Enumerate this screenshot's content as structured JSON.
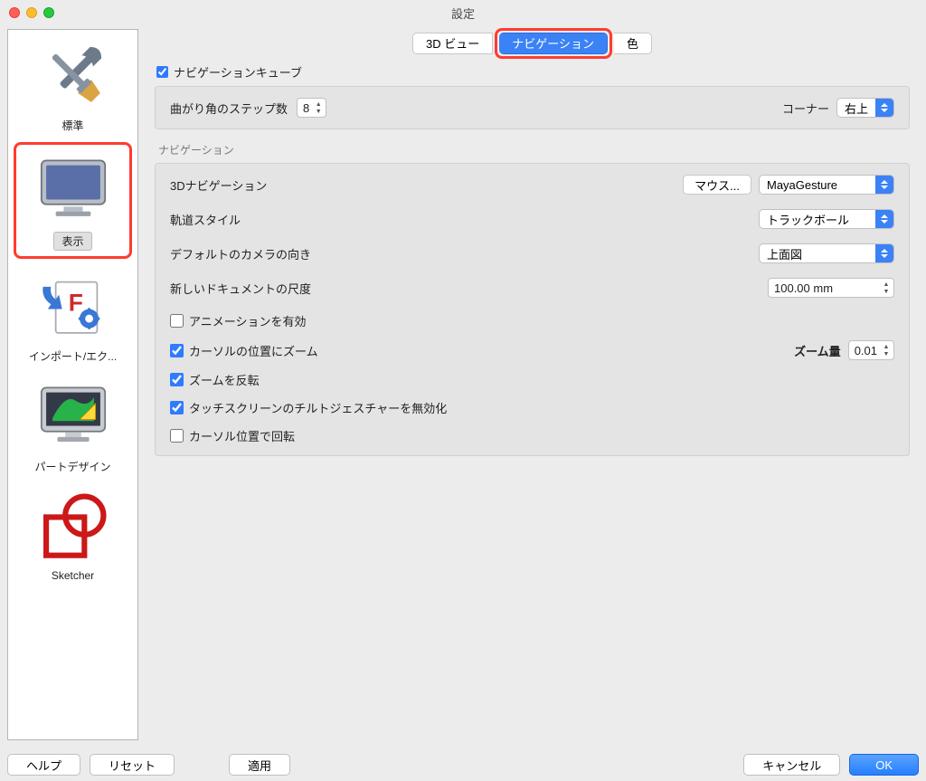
{
  "window": {
    "title": "設定"
  },
  "sidebar": {
    "items": [
      {
        "label": "標準"
      },
      {
        "label": "表示"
      },
      {
        "label": "インポート/エク..."
      },
      {
        "label": "パートデザイン"
      },
      {
        "label": "Sketcher"
      }
    ]
  },
  "tabs": {
    "view3d": "3D ビュー",
    "navigation": "ナビゲーション",
    "color": "色"
  },
  "navcube": {
    "checkbox": "ナビゲーションキューブ",
    "steps_label": "曲がり角のステップ数",
    "steps_value": "8",
    "corner_label": "コーナー",
    "corner_value": "右上"
  },
  "navigation_section": {
    "title": "ナビゲーション",
    "nav3d_label": "3Dナビゲーション",
    "mouse_btn": "マウス...",
    "nav3d_value": "MayaGesture",
    "orbit_label": "軌道スタイル",
    "orbit_value": "トラックボール",
    "camera_label": "デフォルトのカメラの向き",
    "camera_value": "上面図",
    "newdoc_label": "新しいドキュメントの尺度",
    "newdoc_value": "100.00 mm",
    "anim_label": "アニメーションを有効",
    "zoomcursor_label": "カーソルの位置にズーム",
    "zoomstep_label": "ズーム量",
    "zoomstep_value": "0.01",
    "invertzoom_label": "ズームを反転",
    "disable_tilt_label": "タッチスクリーンのチルトジェスチャーを無効化",
    "rotate_cursor_label": "カーソル位置で回転"
  },
  "buttons": {
    "help": "ヘルプ",
    "reset": "リセット",
    "apply": "適用",
    "cancel": "キャンセル",
    "ok": "OK"
  }
}
